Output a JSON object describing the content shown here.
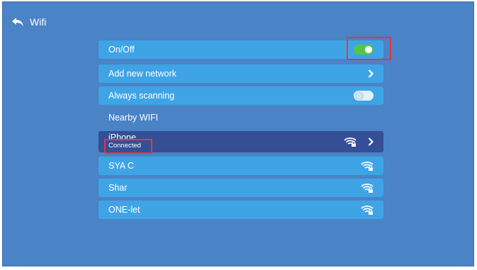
{
  "header": {
    "title": "Wifi"
  },
  "toggle_row": {
    "label": "On/Off",
    "state": "on"
  },
  "add_network": {
    "label": "Add new network"
  },
  "scanning": {
    "label": "Always scanning",
    "state": "off"
  },
  "section_title": "Nearby WIFI",
  "networks": [
    {
      "name": "iPhone",
      "status": "Connected",
      "selected": true
    },
    {
      "name": "SYA C"
    },
    {
      "name": "Shar"
    },
    {
      "name": "ONE-let"
    }
  ],
  "colors": {
    "background": "#4a83c6",
    "row": "#3fa4e6",
    "selected_row": "#344f95",
    "toggle_on": "#56c54a",
    "highlight": "#e0393e"
  },
  "icons": {
    "back": "back-arrow-icon",
    "chevron": "chevron-right-icon",
    "wifi": "wifi-lock-icon"
  }
}
